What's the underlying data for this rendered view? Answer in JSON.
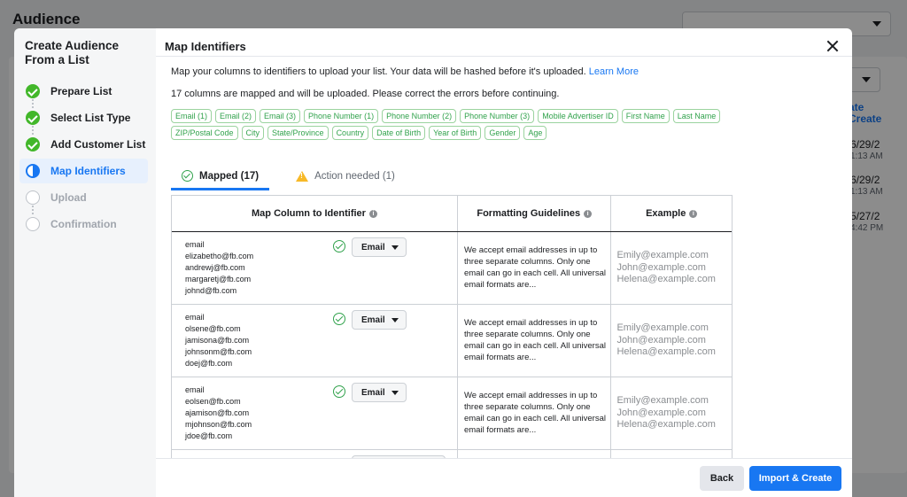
{
  "background": {
    "title": "Audience",
    "link_text": "ate\nCreate",
    "dates": [
      "6/29/2",
      "1:13 AM",
      "6/29/2",
      "1:13 AM",
      "5/27/2",
      "4:42 PM"
    ]
  },
  "sidebar": {
    "title": "Create Audience From a List",
    "steps": [
      {
        "label": "Prepare List",
        "state": "done"
      },
      {
        "label": "Select List Type",
        "state": "done"
      },
      {
        "label": "Add Customer List",
        "state": "done"
      },
      {
        "label": "Map Identifiers",
        "state": "active"
      },
      {
        "label": "Upload",
        "state": "pending"
      },
      {
        "label": "Confirmation",
        "state": "pending"
      }
    ]
  },
  "dialog": {
    "title": "Map Identifiers",
    "intro": "Map your columns to identifiers to upload your list. Your data will be hashed before it's uploaded.",
    "learn_more": "Learn More",
    "summary": "17 columns are mapped and will be uploaded. Please correct the errors before continuing.",
    "chips_row1": [
      "Email (1)",
      "Email (2)",
      "Email (3)",
      "Phone Number (1)",
      "Phone Number (2)",
      "Phone Number (3)",
      "Mobile Advertiser ID",
      "First Name",
      "Last Name"
    ],
    "chips_row2": [
      "ZIP/Postal Code",
      "City",
      "State/Province",
      "Country",
      "Date of Birth",
      "Year of Birth",
      "Gender",
      "Age"
    ],
    "tabs": {
      "mapped": "Mapped (17)",
      "action_needed": "Action needed (1)"
    },
    "table": {
      "headers": [
        "Map Column to Identifier",
        "Formatting Guidelines",
        "Example"
      ],
      "rows": [
        {
          "samples": [
            "email",
            "elizabetho@fb.com",
            "andrewj@fb.com",
            "margaretj@fb.com",
            "johnd@fb.com"
          ],
          "identifier": "Email",
          "guideline": "We accept email addresses in up to three separate columns. Only one email can go in each cell. All universal email formats are...",
          "examples": [
            "Emily@example.com",
            "John@example.com",
            "Helena@example.com"
          ]
        },
        {
          "samples": [
            "email",
            "olsene@fb.com",
            "jamisona@fb.com",
            "johnsonm@fb.com",
            "doej@fb.com"
          ],
          "identifier": "Email",
          "guideline": "We accept email addresses in up to three separate columns. Only one email can go in each cell. All universal email formats are...",
          "examples": [
            "Emily@example.com",
            "John@example.com",
            "Helena@example.com"
          ]
        },
        {
          "samples": [
            "email",
            "eolsen@fb.com",
            "ajamison@fb.com",
            "mjohnson@fb.com",
            "jdoe@fb.com"
          ],
          "identifier": "Email",
          "guideline": "We accept email addresses in up to three separate columns. Only one email can go in each cell. All universal email formats are...",
          "examples": [
            "Emily@example.com",
            "John@example.com",
            "Helena@example.com"
          ]
        }
      ]
    },
    "footer": {
      "back": "Back",
      "import_create": "Import & Create"
    }
  }
}
